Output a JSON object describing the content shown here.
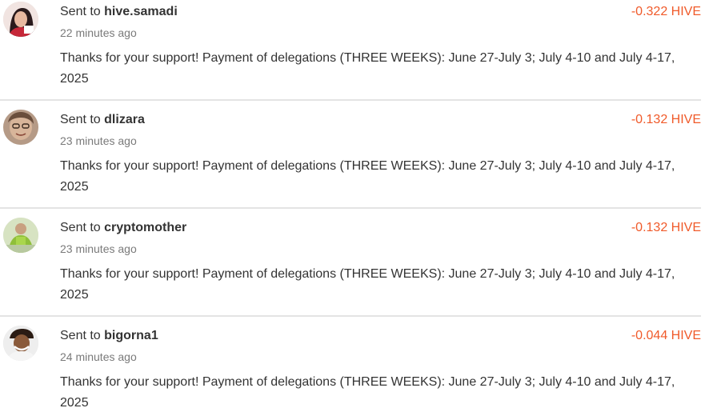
{
  "transactions": [
    {
      "prefix": "Sent to",
      "recipient": "hive.samadi",
      "time": "22 minutes ago",
      "memo": "Thanks for your support! Payment of delegations (THREE WEEKS): June 27-July 3; July 4-10 and July 4-17, 2025",
      "amount": "-0.322 HIVE"
    },
    {
      "prefix": "Sent to",
      "recipient": "dlizara",
      "time": "23 minutes ago",
      "memo": "Thanks for your support! Payment of delegations (THREE WEEKS): June 27-July 3; July 4-10 and July 4-17, 2025",
      "amount": "-0.132 HIVE"
    },
    {
      "prefix": "Sent to",
      "recipient": "cryptomother",
      "time": "23 minutes ago",
      "memo": "Thanks for your support! Payment of delegations (THREE WEEKS): June 27-July 3; July 4-10 and July 4-17, 2025",
      "amount": "-0.132 HIVE"
    },
    {
      "prefix": "Sent to",
      "recipient": "bigorna1",
      "time": "24 minutes ago",
      "memo": "Thanks for your support! Payment of delegations (THREE WEEKS): June 27-July 3; July 4-10 and July 4-17, 2025",
      "amount": "-0.044 HIVE"
    }
  ],
  "colors": {
    "amount_negative": "#f05a2a",
    "divider": "#e4e4e4",
    "text": "#333333",
    "muted": "#7a7a7a"
  },
  "icons": {
    "avatar": "user-avatar-icon"
  }
}
